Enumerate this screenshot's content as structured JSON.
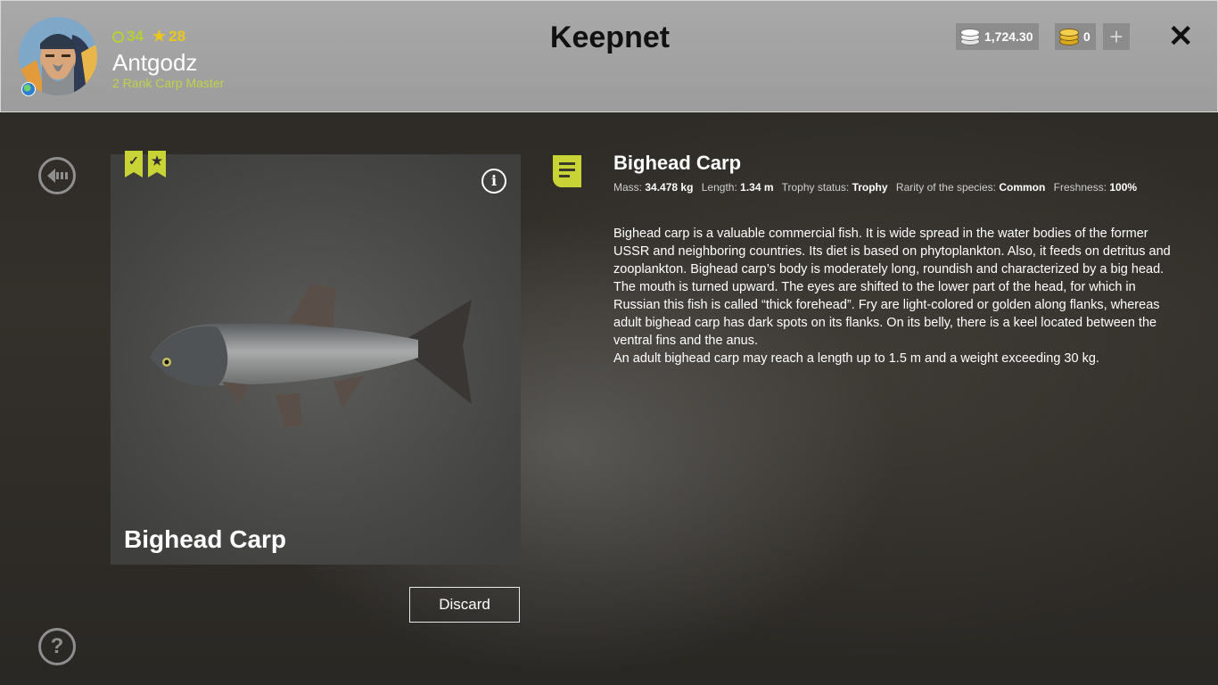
{
  "header": {
    "title": "Keepnet",
    "player": {
      "name": "Antgodz",
      "rank": "2 Rank Carp Master",
      "level": "34",
      "stars": "28"
    },
    "currency": {
      "silver": "1,724.30",
      "gold": "0"
    },
    "icons": {
      "add": "plus-icon",
      "close": "close-icon",
      "region": "globe-icon"
    }
  },
  "sidebar": {
    "back": "back-arrow-icon",
    "help": "help-icon"
  },
  "fish_card": {
    "name": "Bighead Carp",
    "badges": [
      "check-badge-icon",
      "star-badge-icon"
    ],
    "discard_label": "Discard"
  },
  "details": {
    "name": "Bighead Carp",
    "stats": [
      {
        "label": "Mass:",
        "value": "34.478 kg"
      },
      {
        "label": "Length:",
        "value": "1.34 m"
      },
      {
        "label": "Trophy status:",
        "value": "Trophy"
      },
      {
        "label": "Rarity of the species:",
        "value": "Common"
      },
      {
        "label": "Freshness:",
        "value": "100%"
      }
    ],
    "description": [
      "Bighead carp is a valuable commercial fish. It is wide spread in the water bodies of the former USSR and neighboring countries. Its diet is based on phytoplankton. Also, it feeds on detritus and zooplankton. Bighead carp’s body is moderately long, roundish and characterized by a big head. The mouth is turned upward. The eyes are shifted to the lower part of the head, for which in Russian this fish is called “thick forehead”. Fry are light-colored or golden along flanks, whereas adult bighead carp has dark spots on its flanks. On its belly, there is a keel located between the ventral fins and the anus.",
      "An adult bighead carp may reach a length up to 1.5 m and a weight exceeding 30 kg."
    ]
  },
  "colors": {
    "accent": "#c8d436",
    "rank_text": "#c3d247",
    "star": "#e8c81a"
  }
}
